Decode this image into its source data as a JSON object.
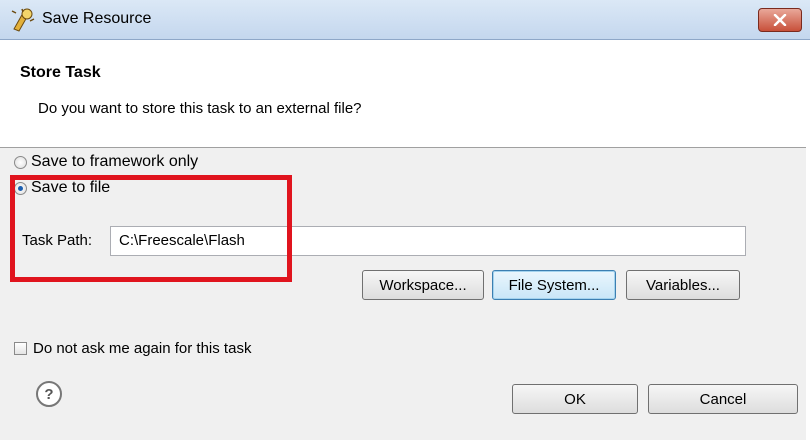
{
  "window": {
    "title": "Save Resource",
    "close_icon": "close-icon",
    "app_icon": "wizard-icon"
  },
  "header": {
    "title": "Store Task",
    "description": "Do you want to store this task to an external file?"
  },
  "options": {
    "framework_only": {
      "label": "Save to framework only",
      "checked": false
    },
    "save_to_file": {
      "label": "Save to file",
      "checked": true
    }
  },
  "task_path": {
    "label": "Task Path:",
    "value": "C:\\Freescale\\Flash"
  },
  "buttons": {
    "workspace": "Workspace...",
    "file_system": "File System...",
    "variables": "Variables..."
  },
  "dont_ask": {
    "label": "Do not ask me again for this task",
    "checked": false
  },
  "footer": {
    "help_icon": "help-icon",
    "ok": "OK",
    "cancel": "Cancel"
  },
  "colors": {
    "highlight": "#e0141e",
    "title_bar": "#c4d7ee",
    "close_button": "#c8503a"
  }
}
